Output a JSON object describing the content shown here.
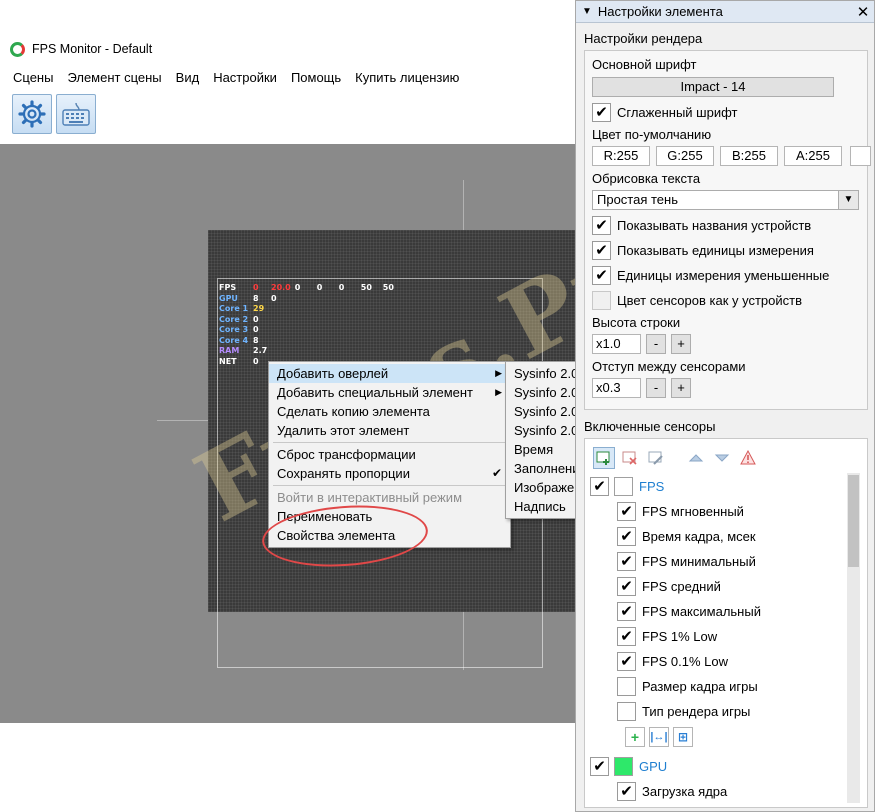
{
  "window": {
    "title": "FPS Monitor - Default"
  },
  "menubar": [
    {
      "label": "Сцены"
    },
    {
      "label": "Элемент сцены"
    },
    {
      "label": "Вид"
    },
    {
      "label": "Настройки"
    },
    {
      "label": "Помощь"
    },
    {
      "label": "Купить лицензию"
    }
  ],
  "toolbar": [
    {
      "name": "settings-gear-button",
      "icon": "gear-icon"
    },
    {
      "name": "keyboard-button",
      "icon": "keyboard-icon"
    }
  ],
  "overlay": {
    "rows": [
      {
        "name": "FPS",
        "values": [
          "0",
          "20.0",
          "0",
          "0",
          "0",
          "50",
          "50"
        ],
        "colors": [
          "#ff3b3b",
          "#ff3b3b",
          "#ffffff",
          "#ffffff",
          "#ffffff",
          "#ffffff",
          "#ffffff"
        ]
      },
      {
        "name": "GPU",
        "values": [
          "8",
          "0"
        ],
        "colors": [
          "#ffffff",
          "#ffffff"
        ]
      },
      {
        "name": "Core 1",
        "values": [
          "29"
        ],
        "colors": [
          "#ffd84a"
        ]
      },
      {
        "name": "Core 2",
        "values": [
          "0"
        ],
        "colors": [
          "#ffffff"
        ]
      },
      {
        "name": "Core 3",
        "values": [
          "0"
        ],
        "colors": [
          "#ffffff"
        ]
      },
      {
        "name": "Core 4",
        "values": [
          "8"
        ],
        "colors": [
          "#ffffff"
        ]
      },
      {
        "name": "RAM",
        "values": [
          "2.7"
        ],
        "colors": [
          "#ffffff"
        ]
      },
      {
        "name": "NET",
        "values": [
          "0"
        ],
        "colors": [
          "#ffffff"
        ]
      }
    ],
    "name_colors": [
      "#ffffff",
      "#6fb4ff",
      "#6fb4ff",
      "#6fb4ff",
      "#6fb4ff",
      "#6fb4ff",
      "#b58cff",
      "#ffffff"
    ]
  },
  "watermark": "Fraps.Pro",
  "context_menu": {
    "items": [
      {
        "label": "Добавить оверлей",
        "submenu": true,
        "active": true
      },
      {
        "label": "Добавить специальный элемент",
        "submenu": true
      },
      {
        "label": "Сделать копию элемента"
      },
      {
        "label": "Удалить этот элемент"
      },
      {
        "separator": true
      },
      {
        "label": "Сброс трансформации"
      },
      {
        "label": "Сохранять пропорции",
        "checked": true
      },
      {
        "separator": true
      },
      {
        "label": "Войти в интерактивный режим",
        "disabled": true
      },
      {
        "label": "Переименовать"
      },
      {
        "label": "Свойства элемента"
      }
    ],
    "submenu_arrow": "▶",
    "check_glyph": "✔"
  },
  "submenu": {
    "items": [
      {
        "label": "Sysinfo 2.0"
      },
      {
        "label": "Sysinfo 2.0"
      },
      {
        "label": "Sysinfo 2.0"
      },
      {
        "label": "Sysinfo 2.0"
      },
      {
        "label": "Время"
      },
      {
        "label": "Заполнение"
      },
      {
        "label": "Изображение"
      },
      {
        "label": "Надпись"
      }
    ]
  },
  "panel": {
    "header_arrow": "▼",
    "title": "Настройки элемента",
    "close": "✕",
    "render_group": "Настройки рендера",
    "main_font_label": "Основной шрифт",
    "main_font_value": "Impact - 14",
    "smooth_font": {
      "label": "Сглаженный шрифт",
      "checked": true
    },
    "default_color_label": "Цвет по-умолчанию",
    "rgba": [
      "R:255",
      "G:255",
      "B:255",
      "A:255"
    ],
    "outline_label": "Обрисовка текста",
    "outline_value": "Простая тень",
    "options": [
      {
        "label": "Показывать названия устройств",
        "checked": true
      },
      {
        "label": "Показывать единицы измерения",
        "checked": true
      },
      {
        "label": "Единицы измерения уменьшенные",
        "checked": true
      },
      {
        "label": "Цвет сенсоров как у устройств",
        "checked": false
      }
    ],
    "row_height_label": "Высота строки",
    "row_height_value": "x1.0",
    "sensor_gap_label": "Отступ между сенсорами",
    "sensor_gap_value": "x0.3",
    "minus": "-",
    "plus": "+",
    "sensors_title": "Включенные сенсоры",
    "sensor_tools": [
      "add-sensor-icon",
      "remove-sensor-icon",
      "edit-sensor-icon",
      "move-up-icon",
      "move-down-icon",
      "warning-icon"
    ],
    "sensors": {
      "fps_group": {
        "label": "FPS",
        "checked": true,
        "color": "#ffffff"
      },
      "fps_items": [
        {
          "label": "FPS мгновенный",
          "checked": true
        },
        {
          "label": "Время кадра, мсек",
          "checked": true
        },
        {
          "label": "FPS минимальный",
          "checked": true
        },
        {
          "label": "FPS средний",
          "checked": true
        },
        {
          "label": "FPS максимальный",
          "checked": true
        },
        {
          "label": "FPS 1% Low",
          "checked": true
        },
        {
          "label": "FPS 0.1% Low",
          "checked": true
        },
        {
          "label": "Размер кадра игры",
          "checked": false
        },
        {
          "label": "Тип рендера игры",
          "checked": false
        }
      ],
      "gpu_group": {
        "label": "GPU",
        "checked": true,
        "color": "#2ee86a"
      },
      "gpu_items": [
        {
          "label": "Загрузка ядра",
          "checked": true
        }
      ]
    },
    "check_glyph": "✔"
  },
  "colors": {
    "accent": "#1f7fd0",
    "highlight": "#cce4f7",
    "annotation": "#e04848"
  }
}
